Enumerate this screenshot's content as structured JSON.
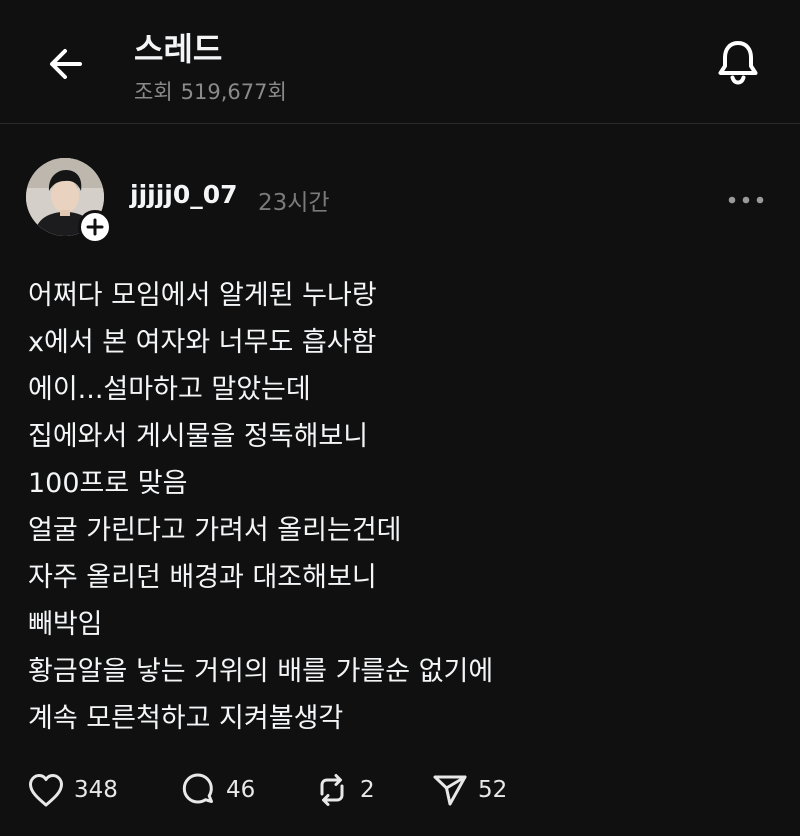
{
  "header": {
    "title": "스레드",
    "views_label": "조회",
    "views_count": "519,677회",
    "back_icon": "arrow-left-icon",
    "bell_icon": "bell-icon"
  },
  "post": {
    "username": "jjjjj0_07",
    "time": "23시간",
    "avatar_icon": "avatar",
    "follow_icon": "plus-icon",
    "more_icon": "more-horizontal-icon",
    "lines": [
      "어쩌다 모임에서 알게된 누나랑",
      "x에서 본 여자와 너무도 흡사함",
      "에이...설마하고 말았는데",
      "집에와서 게시물을 정독해보니",
      "100프로 맞음",
      "얼굴 가린다고 가려서 올리는건데",
      "자주 올리던 배경과 대조해보니",
      "빼박임",
      "황금알을 낳는 거위의 배를 가를순 없기에",
      "계속 모른척하고 지켜볼생각"
    ]
  },
  "actions": {
    "likes": "348",
    "comments": "46",
    "reposts": "2",
    "shares": "52"
  },
  "colors": {
    "background": "#101010",
    "text": "#f3f5f7",
    "muted": "#8a8a8a"
  }
}
